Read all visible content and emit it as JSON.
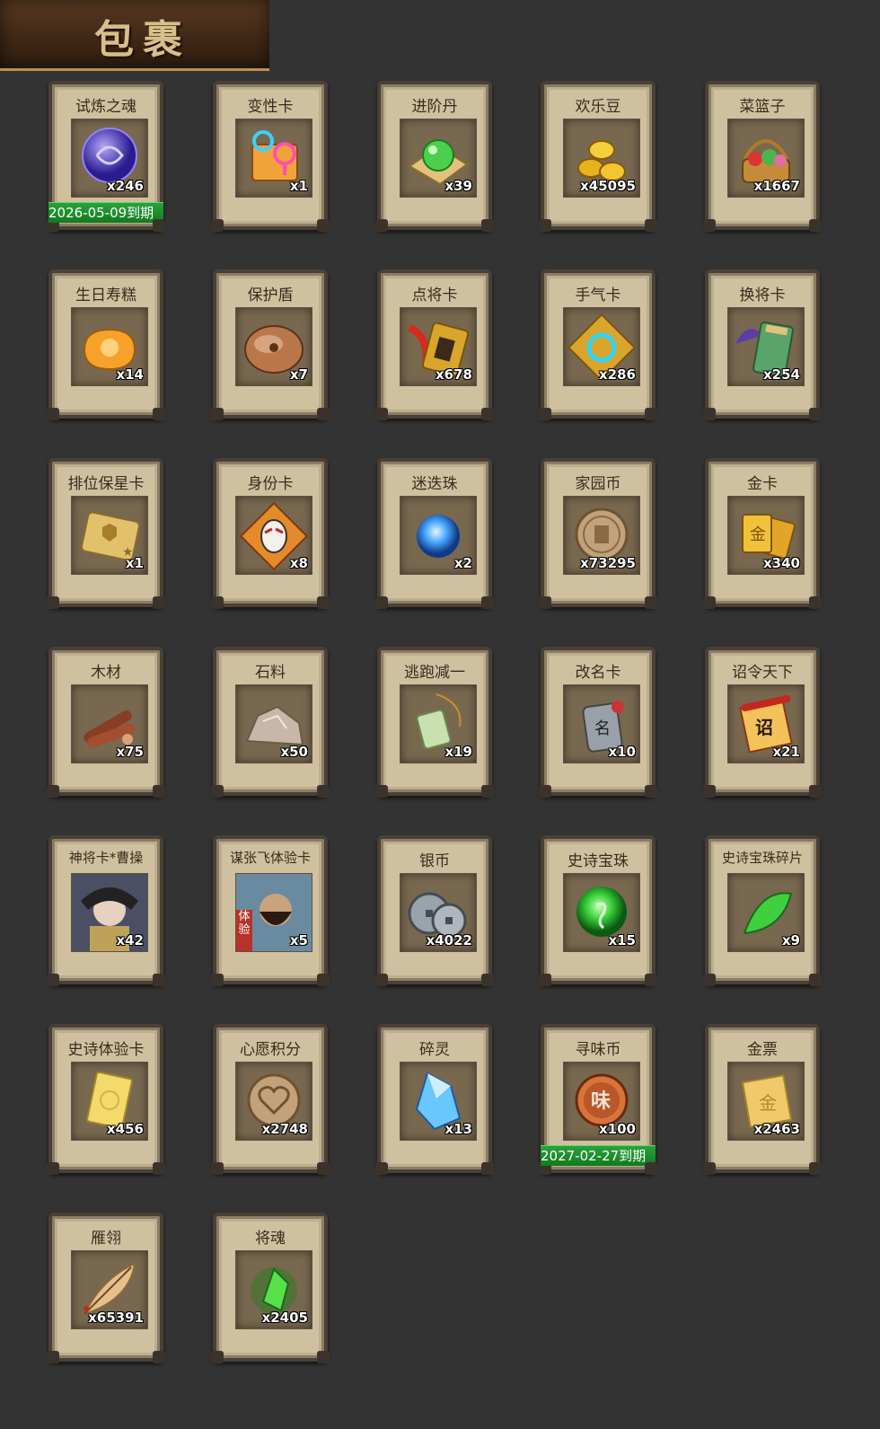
{
  "header": {
    "title": "包裹"
  },
  "items": [
    {
      "name": "试炼之魂",
      "qty": "x246",
      "icon": "purple-dragon-orb-icon",
      "expiry": "2026-05-09到期"
    },
    {
      "name": "变性卡",
      "qty": "x1",
      "icon": "gender-card-icon"
    },
    {
      "name": "进阶丹",
      "qty": "x39",
      "icon": "green-pill-icon"
    },
    {
      "name": "欢乐豆",
      "qty": "x45095",
      "icon": "gold-beans-icon"
    },
    {
      "name": "菜篮子",
      "qty": "x1667",
      "icon": "vegetable-basket-icon"
    },
    {
      "name": "生日寿糕",
      "qty": "x14",
      "icon": "birthday-cake-icon"
    },
    {
      "name": "保护盾",
      "qty": "x7",
      "icon": "shield-icon"
    },
    {
      "name": "点将卡",
      "qty": "x678",
      "icon": "general-pick-card-icon"
    },
    {
      "name": "手气卡",
      "qty": "x286",
      "icon": "luck-card-icon"
    },
    {
      "name": "换将卡",
      "qty": "x254",
      "icon": "swap-general-card-icon"
    },
    {
      "name": "排位保星卡",
      "qty": "x1",
      "icon": "rank-star-card-icon"
    },
    {
      "name": "身份卡",
      "qty": "x8",
      "icon": "identity-mask-card-icon"
    },
    {
      "name": "迷迭珠",
      "qty": "x2",
      "icon": "blue-orb-icon"
    },
    {
      "name": "家园币",
      "qty": "x73295",
      "icon": "home-coin-icon"
    },
    {
      "name": "金卡",
      "qty": "x340",
      "icon": "gold-card-icon"
    },
    {
      "name": "木材",
      "qty": "x75",
      "icon": "wood-icon"
    },
    {
      "name": "石料",
      "qty": "x50",
      "icon": "stone-icon"
    },
    {
      "name": "逃跑减一",
      "qty": "x19",
      "icon": "jade-tag-icon"
    },
    {
      "name": "改名卡",
      "qty": "x10",
      "icon": "rename-card-icon"
    },
    {
      "name": "诏令天下",
      "qty": "x21",
      "icon": "imperial-scroll-icon"
    },
    {
      "name": "神将卡*曹操",
      "qty": "x42",
      "icon": "cao-cao-portrait-icon"
    },
    {
      "name": "谋张飞体验卡",
      "qty": "x5",
      "icon": "zhang-fei-portrait-icon",
      "badge": "体验"
    },
    {
      "name": "银币",
      "qty": "x4022",
      "icon": "silver-coins-icon"
    },
    {
      "name": "史诗宝珠",
      "qty": "x15",
      "icon": "epic-green-orb-icon"
    },
    {
      "name": "史诗宝珠碎片",
      "qty": "x9",
      "icon": "green-leaf-shard-icon"
    },
    {
      "name": "史诗体验卡",
      "qty": "x456",
      "icon": "epic-trial-card-icon"
    },
    {
      "name": "心愿积分",
      "qty": "x2748",
      "icon": "heart-coin-icon"
    },
    {
      "name": "碎灵",
      "qty": "x13",
      "icon": "blue-crystal-icon"
    },
    {
      "name": "寻味币",
      "qty": "x100",
      "icon": "taste-coin-icon",
      "expiry": "2027-02-27到期"
    },
    {
      "name": "金票",
      "qty": "x2463",
      "icon": "gold-ticket-icon"
    },
    {
      "name": "雁翎",
      "qty": "x65391",
      "icon": "feather-icon"
    },
    {
      "name": "将魂",
      "qty": "x2405",
      "icon": "green-soul-crystal-icon"
    }
  ]
}
